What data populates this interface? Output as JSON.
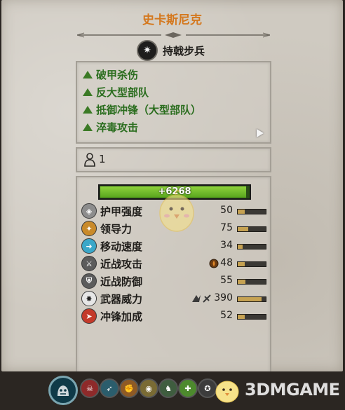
{
  "header": {
    "title": "史卡斯尼克",
    "unit_type_label": "持戟步兵",
    "unit_type_icon": "spear-infantry-icon"
  },
  "abilities": [
    {
      "label": "破甲杀伤"
    },
    {
      "label": "反大型部队"
    },
    {
      "label": "抵御冲锋（大型部队）"
    },
    {
      "label": "淬毒攻击"
    }
  ],
  "unit_count": "1",
  "health": {
    "value": "6268",
    "fraction": 0.98,
    "bar_color": "#7fc62f"
  },
  "stats": [
    {
      "label": "护甲强度",
      "value": "50",
      "fraction": 0.25,
      "icon": "armor-icon",
      "color": "#8d8d8d"
    },
    {
      "label": "领导力",
      "value": "75",
      "fraction": 0.38,
      "icon": "leadership-icon",
      "color": "#c98a2a"
    },
    {
      "label": "移动速度",
      "value": "34",
      "fraction": 0.17,
      "icon": "speed-icon",
      "color": "#3aa7c9"
    },
    {
      "label": "近战攻击",
      "value": "48",
      "fraction": 0.24,
      "icon": "melee-attack-icon",
      "color": "#5c5c5c",
      "extra_icon": "poison-icon"
    },
    {
      "label": "近战防御",
      "value": "55",
      "fraction": 0.28,
      "icon": "melee-defense-icon",
      "color": "#5c5c5c"
    },
    {
      "label": "武器威力",
      "value": "390",
      "fraction": 0.85,
      "icon": "weapon-strength-icon",
      "color": "#e6e6e6",
      "extra_icon": "armour-piercing-icon"
    },
    {
      "label": "冲锋加成",
      "value": "52",
      "fraction": 0.26,
      "icon": "charge-bonus-icon",
      "color": "#c43a2a"
    }
  ],
  "bottom_bar": {
    "unit_card_icon": "goblin-unit-icon",
    "attributes": [
      {
        "icon": "frenzy-icon",
        "color": "#8e2a2a"
      },
      {
        "icon": "trample-icon",
        "color": "#2b5d6c"
      },
      {
        "icon": "expendable-icon",
        "color": "#8e5a25"
      },
      {
        "icon": "vision-icon",
        "color": "#7a6b34"
      },
      {
        "icon": "hide-icon",
        "color": "#3f5d3f"
      },
      {
        "icon": "regen-icon",
        "color": "#4d8a2d"
      },
      {
        "icon": "immune-icon",
        "color": "#3c3c3c"
      }
    ],
    "logo_text": "3DMGAME"
  }
}
